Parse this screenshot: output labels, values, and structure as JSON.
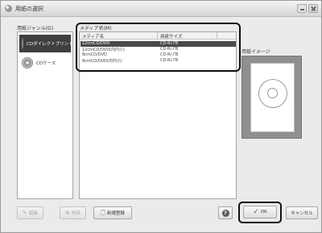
{
  "window": {
    "title": "用紙の選択"
  },
  "genre": {
    "label": "用紙ジャンル(G)",
    "items": [
      {
        "label": "CDダイレクトプリント",
        "icon": "cd-print-icon",
        "selected": true
      },
      {
        "label": "CDケース",
        "icon": "cd-case-icon",
        "selected": false
      }
    ]
  },
  "media": {
    "label": "メディア名(M)",
    "columns": [
      "メディア名",
      "用紙サイズ"
    ],
    "rows": [
      {
        "name": "12cmCD/DVD",
        "size": "CD-R/-ΓB",
        "selected": true
      },
      {
        "name": "12cmCD/DVD(内円小)",
        "size": "CD-R/-ΓB",
        "selected": false
      },
      {
        "name": "8cmCD/DVD",
        "size": "CD-R/-ΓB",
        "selected": false
      },
      {
        "name": "8cmCD/DVD(内円小)",
        "size": "CD-R/-ΓB",
        "selected": false
      }
    ]
  },
  "preview": {
    "label": "用紙イメージ"
  },
  "buttons": {
    "edit": "編集",
    "delete": "削除",
    "new": "新規登録",
    "ok": "OK",
    "cancel": "キャンセル"
  }
}
